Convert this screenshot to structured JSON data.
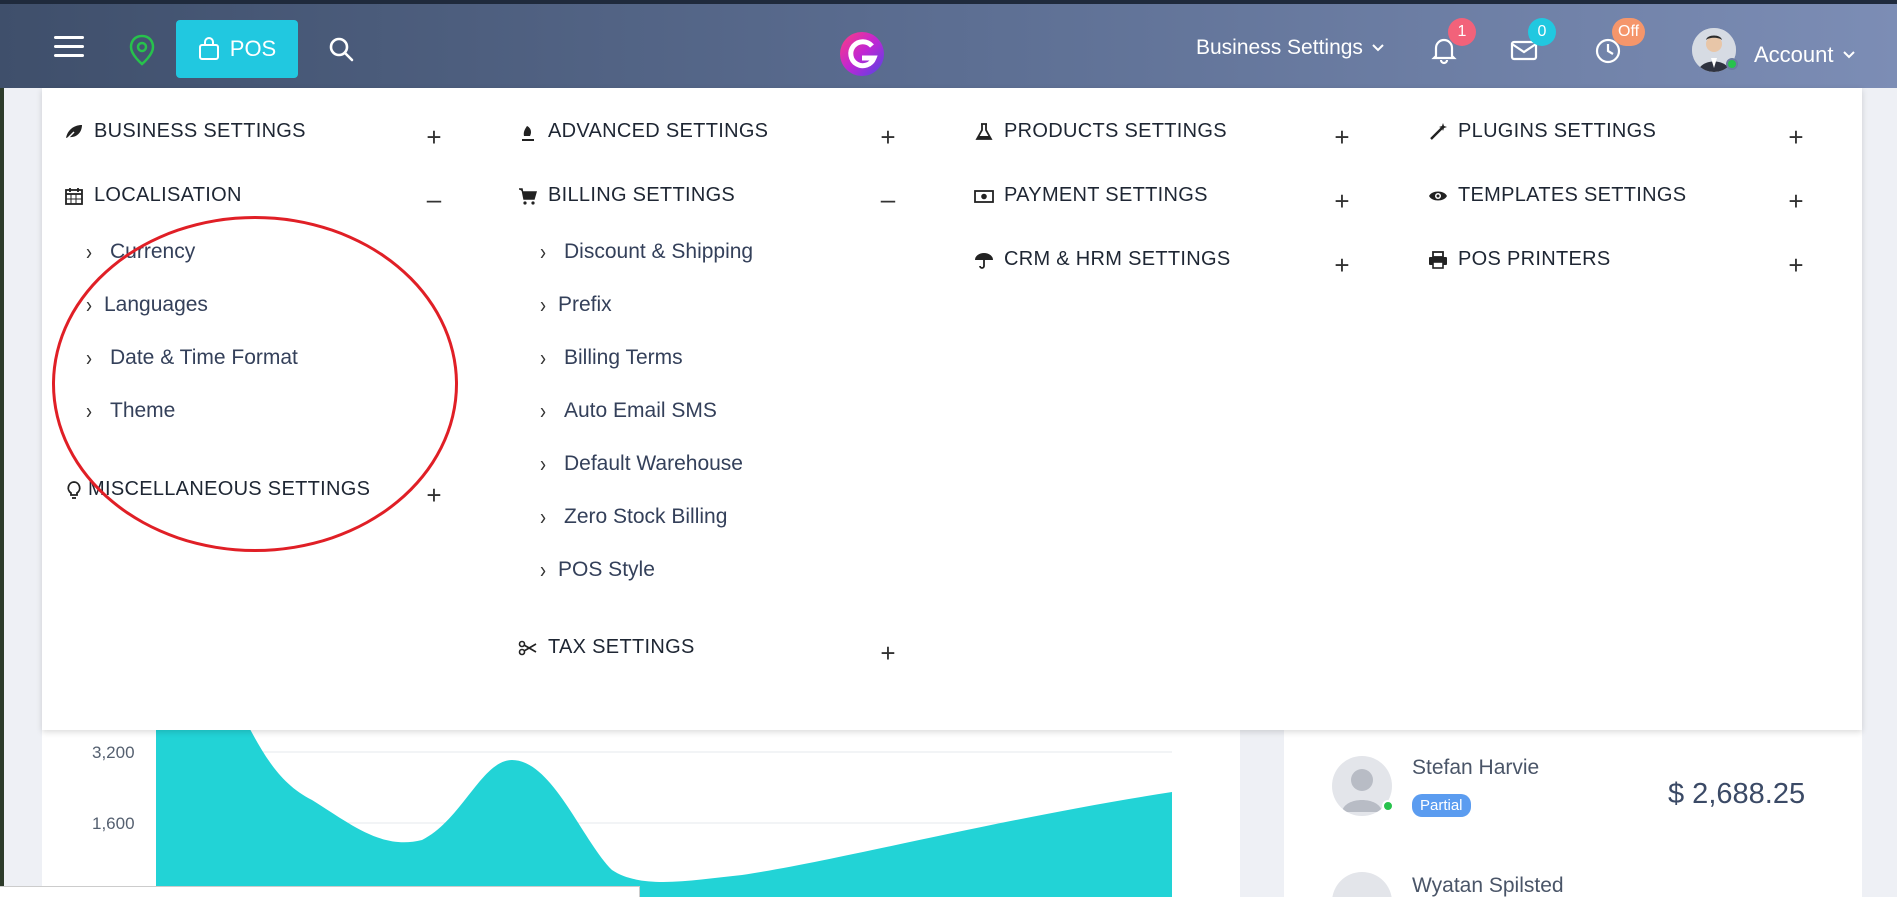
{
  "topbar": {
    "pos_label": "POS",
    "business_settings_label": "Business Settings",
    "notifications_count": "1",
    "messages_count": "0",
    "clock_status": "Off",
    "account_label": "Account"
  },
  "menu": {
    "col1": {
      "business_settings": "BUSINESS SETTINGS",
      "localisation": "LOCALISATION",
      "localisation_items": [
        "Currency",
        "Languages",
        "Date & Time Format",
        "Theme"
      ],
      "miscellaneous": "MISCELLANEOUS SETTINGS"
    },
    "col2": {
      "advanced": "ADVANCED SETTINGS",
      "billing": "BILLING SETTINGS",
      "billing_items": [
        "Discount & Shipping",
        "Prefix",
        "Billing Terms",
        "Auto Email SMS",
        "Default Warehouse",
        "Zero Stock Billing",
        "POS Style"
      ],
      "tax": "TAX SETTINGS"
    },
    "col3": {
      "products": "PRODUCTS SETTINGS",
      "payment": "PAYMENT SETTINGS",
      "crm_hrm": "CRM & HRM SETTINGS"
    },
    "col4": {
      "plugins": "PLUGINS SETTINGS",
      "templates": "TEMPLATES SETTINGS",
      "pos_printers": "POS PRINTERS"
    },
    "expand_symbol": "+",
    "collapse_symbol": "–",
    "chevron": "›"
  },
  "chart_data": {
    "type": "area",
    "yticks": [
      "3,200",
      "1,600"
    ],
    "color": "#22d3d6"
  },
  "customers": [
    {
      "name": "Stefan Harvie",
      "badge": "Partial",
      "amount": "$ 2,688.25"
    },
    {
      "name": "Wyatan Spilsted"
    }
  ],
  "colors": {
    "accent": "#21c8e0",
    "annotation": "#e01f26",
    "area": "#22d3d6"
  }
}
